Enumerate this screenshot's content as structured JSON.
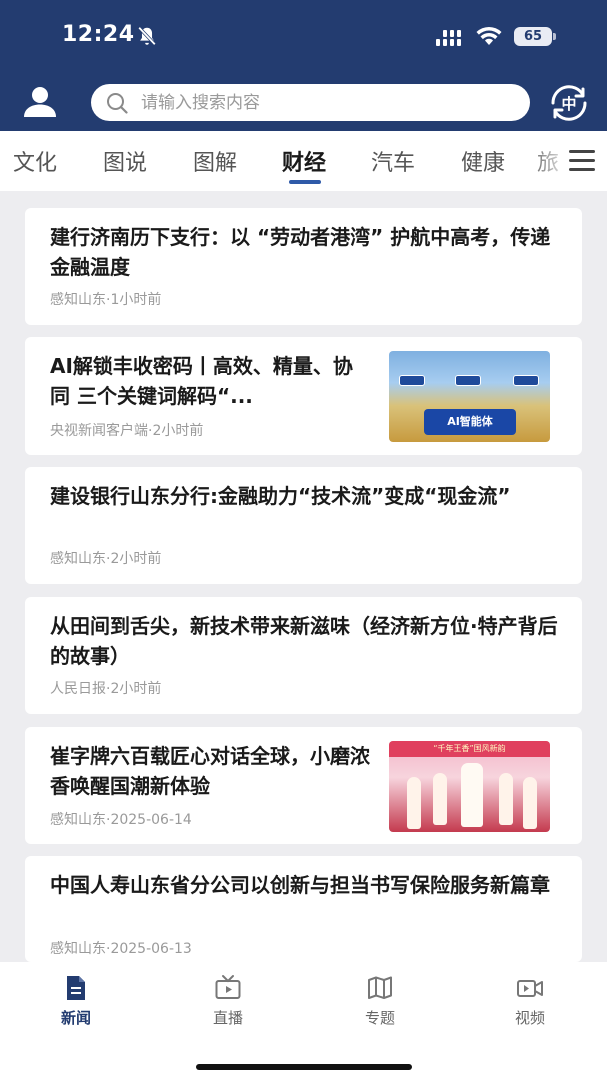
{
  "status_bar": {
    "time": "12:24",
    "battery": "65"
  },
  "header": {
    "search": {
      "placeholder": "请输入搜索内容",
      "value": ""
    },
    "lang_toggle": "中"
  },
  "tabs": [
    {
      "label": "文化",
      "active": false
    },
    {
      "label": "图说",
      "active": false
    },
    {
      "label": "图解",
      "active": false
    },
    {
      "label": "财经",
      "active": true
    },
    {
      "label": "汽车",
      "active": false
    },
    {
      "label": "健康",
      "active": false
    },
    {
      "label": "旅",
      "active": false
    }
  ],
  "news": [
    {
      "title": "建行济南历下支行：以 “劳动者港湾” 护航中高考，传递金融温度",
      "source": "感知山东",
      "time": "1小时前"
    },
    {
      "title": "AI解锁丰收密码丨高效、精量、协同 三个关键词解码“...",
      "source": "央视新闻客户端",
      "time": "2小时前",
      "thumb_caption": "AI智能体"
    },
    {
      "title": "建设银行山东分行:金融助力“技术流”变成“现金流”",
      "source": "感知山东",
      "time": "2小时前"
    },
    {
      "title": "从田间到舌尖，新技术带来新滋味（经济新方位·特产背后的故事）",
      "source": "人民日报",
      "time": "2小时前"
    },
    {
      "title": "崔字牌六百载匠心对话全球，小磨浓香唤醒国潮新体验",
      "source": "感知山东",
      "time": "2025-06-14",
      "thumb_caption": "“千年王香”国风新韵"
    },
    {
      "title": "中国人寿山东省分公司以创新与担当书写保险服务新篇章",
      "source": "感知山东",
      "time": "2025-06-13"
    }
  ],
  "bottom_nav": [
    {
      "label": "新闻",
      "icon": "document-icon",
      "active": true
    },
    {
      "label": "直播",
      "icon": "tv-icon",
      "active": false
    },
    {
      "label": "专题",
      "icon": "map-book-icon",
      "active": false
    },
    {
      "label": "视频",
      "icon": "video-camera-icon",
      "active": false
    }
  ],
  "colors": {
    "header_bg": "#233c70",
    "accent": "#2f5aa8",
    "page_bg": "#ededf0"
  }
}
